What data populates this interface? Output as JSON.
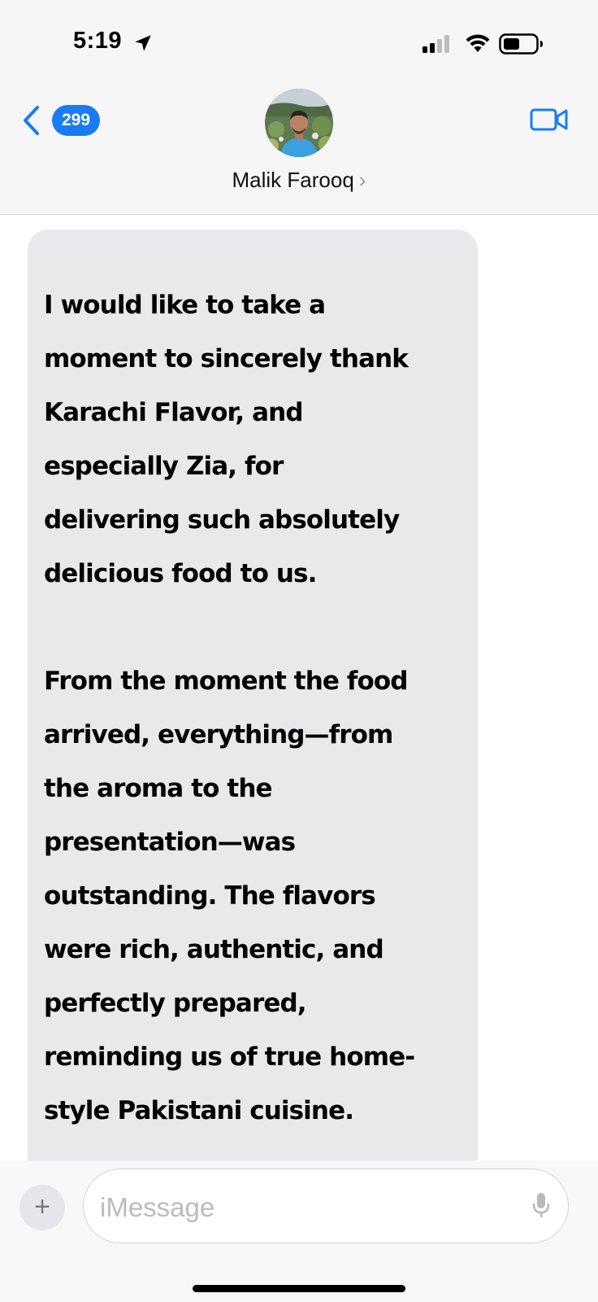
{
  "status_bar": {
    "time": "5:19",
    "icons": [
      "location-arrow-icon",
      "cellular-signal-icon",
      "wifi-icon",
      "battery-icon"
    ]
  },
  "header": {
    "back_badge_count": "299",
    "contact_name": "Malik Farooq",
    "contact_chevron": "›",
    "icons": [
      "chevron-left-icon",
      "video-camera-icon"
    ],
    "accent_color": "#1a7cf5"
  },
  "message": {
    "paragraph_1": [
      "I would like to take a",
      "moment to sincerely thank",
      "Karachi Flavor, and",
      "especially Zia, for",
      "delivering such absolutely",
      "delicious food to us."
    ],
    "paragraph_2": [
      "From the moment the food",
      "arrived, everything—from",
      "the aroma to the",
      "presentation—was",
      "outstanding. The flavors",
      "were rich, authentic, and",
      "perfectly prepared,",
      "reminding us of true home-",
      "style Pakistani cuisine."
    ],
    "bubble_color": "#e9e9eb"
  },
  "compose": {
    "add_label": "+",
    "placeholder": "iMessage",
    "icons": [
      "plus-icon",
      "microphone-icon"
    ]
  }
}
